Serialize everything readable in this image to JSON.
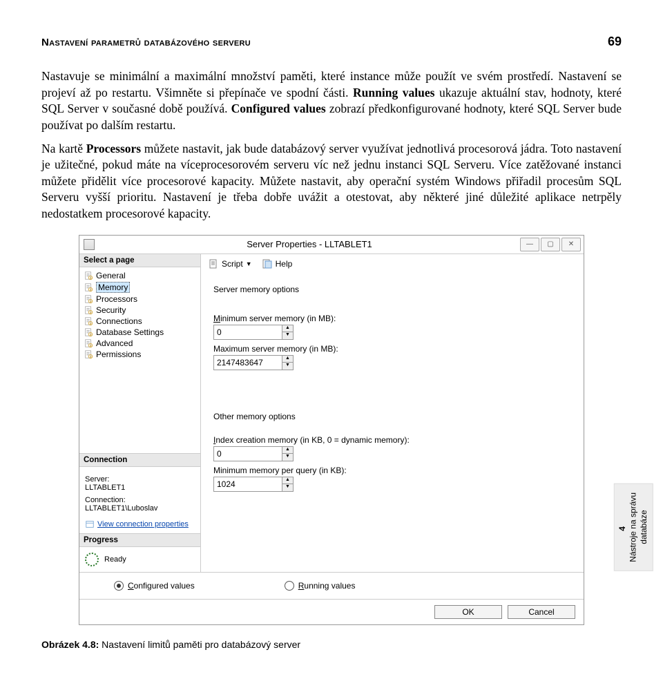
{
  "header": {
    "title": "Nastavení parametrů databázového serveru",
    "page_number": "69"
  },
  "body": {
    "p1_a": "Nastavuje se minimální a maximální množství paměti, které instance může použít ve svém prostředí. Nastavení se projeví až po restartu. Všimněte si přepínače ve spodní části. ",
    "p1_running": "Running values",
    "p1_b": " ukazuje aktuální stav, hodnoty, které SQL Server v současné době používá. ",
    "p1_configured": "Configured values",
    "p1_c": " zobrazí předkonfigurované hodnoty, které SQL Server bude používat po dalším restartu.",
    "p2_a": "Na kartě ",
    "p2_proc": "Processors",
    "p2_b": " můžete nastavit, jak bude databázový server využívat jednotlivá procesorová jádra. Toto nastavení je užitečné, pokud máte na víceprocesorovém serveru víc než jednu instanci SQL Serveru. Více zatěžované instanci můžete přidělit více procesorové kapacity. Můžete nastavit, aby operační systém Windows přiřadil procesům SQL Serveru vyšší prioritu. Nastavení je třeba dobře uvážit a otestovat, aby některé jiné důležité aplikace netrpěly nedostatkem procesorové kapacity."
  },
  "window": {
    "title": "Server Properties - LLTABLET1",
    "select_page": "Select a page",
    "pages": [
      "General",
      "Memory",
      "Processors",
      "Security",
      "Connections",
      "Database Settings",
      "Advanced",
      "Permissions"
    ],
    "selected_index": 1,
    "connection_hdr": "Connection",
    "server_lbl": "Server:",
    "server_val": "LLTABLET1",
    "conn_lbl": "Connection:",
    "conn_val": "LLTABLET1\\Luboslav",
    "view_conn": "View connection properties",
    "progress_hdr": "Progress",
    "ready": "Ready",
    "toolbar": {
      "script": "Script",
      "help": "Help"
    },
    "props": {
      "group1": "Server memory options",
      "min_label": "Minimum server memory (in MB):",
      "min_val": "0",
      "max_label": "Maximum server memory (in MB):",
      "max_val": "2147483647",
      "group2": "Other memory options",
      "idx_label": "Index creation memory (in KB, 0 = dynamic memory):",
      "idx_val": "0",
      "minq_label": "Minimum memory per query (in KB):",
      "minq_val": "1024"
    },
    "radios": {
      "configured": "Configured values",
      "running": "Running values"
    },
    "buttons": {
      "ok": "OK",
      "cancel": "Cancel"
    }
  },
  "side_tab": {
    "num": "4",
    "line1": "Nástroje na správu",
    "line2": "databáze"
  },
  "caption": {
    "label": "Obrázek 4.8:",
    "text": " Nastavení limitů paměti pro databázový server"
  }
}
